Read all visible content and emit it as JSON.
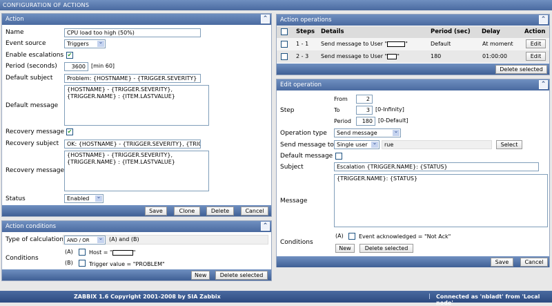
{
  "header": {
    "title": "CONFIGURATION OF ACTIONS"
  },
  "action": {
    "title": "Action",
    "name_label": "Name",
    "name_value": "CPU load too high (50%)",
    "event_source_label": "Event source",
    "event_source_value": "Triggers",
    "enable_escalations_label": "Enable escalations",
    "enable_escalations": true,
    "period_label": "Period (seconds)",
    "period_value": "3600",
    "period_hint": "[min 60]",
    "default_subject_label": "Default subject",
    "default_subject_value": "Problem: {HOSTNAME} - {TRIGGER.SEVERITY}",
    "default_message_label": "Default message",
    "default_message_value": "{HOSTNAME} - {TRIGGER.SEVERITY},\n{TRIGGER.NAME} : {ITEM.LASTVALUE}",
    "recovery_message_check_label": "Recovery message",
    "recovery_enabled": true,
    "recovery_subject_label": "Recovery subject",
    "recovery_subject_value": "OK: {HOSTNAME} - {TRIGGER.SEVERITY}, {TRIGGER.NAME}",
    "recovery_message_label": "Recovery message",
    "recovery_message_value": "{HOSTNAME} - {TRIGGER.SEVERITY},\n{TRIGGER.NAME} : {ITEM.LASTVALUE}",
    "status_label": "Status",
    "status_value": "Enabled",
    "buttons": {
      "save": "Save",
      "clone": "Clone",
      "delete": "Delete",
      "cancel": "Cancel"
    }
  },
  "conditions": {
    "title": "Action conditions",
    "calc_label": "Type of calculation",
    "calc_value": "AND / OR",
    "calc_expr": "(A) and (B)",
    "label": "Conditions",
    "items": [
      {
        "id": "(A)",
        "text_pre": "Host = \"",
        "text_post": "\""
      },
      {
        "id": "(B)",
        "text": "Trigger value = \"PROBLEM\""
      }
    ],
    "buttons": {
      "new": "New",
      "delete_selected": "Delete selected"
    }
  },
  "operations": {
    "title": "Action operations",
    "columns": [
      "Steps",
      "Details",
      "Period (sec)",
      "Delay",
      "Action"
    ],
    "rows": [
      {
        "steps": "1 - 1",
        "details_pre": "Send message to User \"",
        "details_post": "\"",
        "period": "Default",
        "delay": "At moment",
        "action": "Edit"
      },
      {
        "steps": "2 - 3",
        "details_pre": "Send message to User \"",
        "details_post": "\"",
        "period": "180",
        "delay": "01:00:00",
        "action": "Edit"
      }
    ],
    "delete_selected": "Delete selected"
  },
  "edit": {
    "title": "Edit operation",
    "step_label": "Step",
    "from_label": "From",
    "from_value": "2",
    "to_label": "To",
    "to_value": "3",
    "to_hint": "[0-Infinity]",
    "period_label": "Period",
    "period_value": "180",
    "period_hint": "[0-Default]",
    "op_type_label": "Operation type",
    "op_type_value": "Send message",
    "send_to_label": "Send message to",
    "send_to_value": "Single user",
    "send_to_user": "rue",
    "select_button": "Select",
    "default_message_label": "Default message",
    "subject_label": "Subject",
    "subject_value": "Escalation {TRIGGER.NAME}: {STATUS}",
    "message_label": "Message",
    "message_value": "{TRIGGER.NAME}: {STATUS}",
    "conditions_label": "Conditions",
    "condition_id": "(A)",
    "condition_text": "Event acknowledged = \"Not Ack\"",
    "new_button": "New",
    "delete_selected_button": "Delete selected",
    "save": "Save",
    "cancel": "Cancel"
  },
  "footer": {
    "copyright": "ZABBIX 1.6 Copyright 2001-2008 by  SIA Zabbix",
    "connected": "Connected as 'nbladt' from 'Local node'"
  }
}
